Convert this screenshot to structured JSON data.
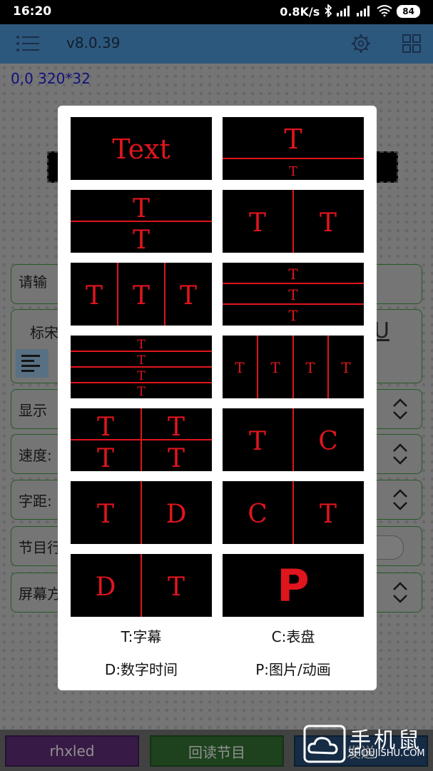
{
  "status_bar": {
    "time": "16:20",
    "network_speed": "0.8K/s",
    "battery": "84",
    "icons": [
      "bluetooth-icon",
      "signal-icon",
      "signal-icon",
      "wifi-icon"
    ]
  },
  "app_bar": {
    "version": "v8.0.39",
    "icons": [
      "menu-icon",
      "gear-icon",
      "grid-icon"
    ]
  },
  "screen": {
    "coords": "0,0 320*32"
  },
  "form": {
    "input_placeholder": "请输",
    "font_label": "标宋",
    "display_label": "显示",
    "speed_label": "速度:",
    "spacing_label": "字距:",
    "program_label": "节目行",
    "screen_label": "屏幕方"
  },
  "bottom_buttons": {
    "rhxled": "rhxled",
    "readback": "回读节目",
    "send": "发送"
  },
  "dialog": {
    "tiles": [
      {
        "name": "text",
        "labels": [
          "Text"
        ]
      },
      {
        "name": "top-bottom-small",
        "labels": [
          "T",
          "T"
        ]
      },
      {
        "name": "two-rows",
        "labels": [
          "T",
          "T"
        ]
      },
      {
        "name": "two-cols",
        "labels": [
          "T",
          "T"
        ]
      },
      {
        "name": "three-cols",
        "labels": [
          "T",
          "T",
          "T"
        ]
      },
      {
        "name": "three-rows",
        "labels": [
          "T",
          "T",
          "T"
        ]
      },
      {
        "name": "four-rows",
        "labels": [
          "T",
          "T",
          "T",
          "T"
        ]
      },
      {
        "name": "four-cols",
        "labels": [
          "T",
          "T",
          "T",
          "T"
        ]
      },
      {
        "name": "grid-2x2",
        "labels": [
          "T",
          "T",
          "T",
          "T"
        ]
      },
      {
        "name": "text-clock",
        "labels": [
          "T",
          "C"
        ]
      },
      {
        "name": "text-digital",
        "labels": [
          "T",
          "D"
        ]
      },
      {
        "name": "clock-text",
        "labels": [
          "C",
          "T"
        ]
      },
      {
        "name": "digital-text",
        "labels": [
          "D",
          "T"
        ]
      },
      {
        "name": "picture",
        "labels": [
          "P"
        ]
      }
    ],
    "legend": [
      "T:字幕",
      "C:表盘",
      "D:数字时间",
      "P:图片/动画"
    ]
  },
  "watermark": {
    "title": "手机鼠",
    "site": "SHOUJISHU.COM"
  },
  "colors": {
    "led_red": "#e0151d",
    "accent_blue": "#4a8fcb",
    "panel_border": "#3f8f3f"
  }
}
